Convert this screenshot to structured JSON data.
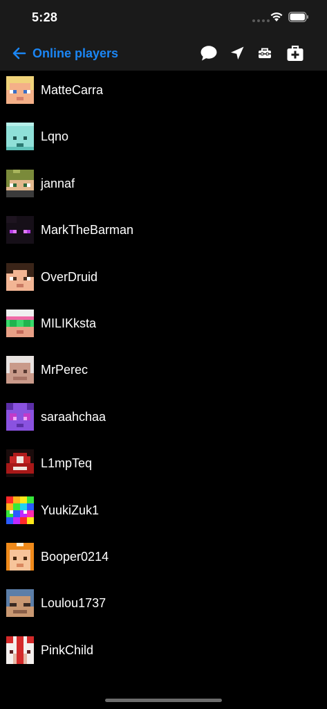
{
  "status_bar": {
    "time": "5:28",
    "signal_icon": "cellular-signal-icon",
    "wifi_icon": "wifi-icon",
    "battery_icon": "battery-icon"
  },
  "nav": {
    "back_icon": "arrow-left-icon",
    "title": "Online players",
    "actions": [
      {
        "name": "chat-button",
        "icon": "speech-bubble-icon"
      },
      {
        "name": "location-button",
        "icon": "location-arrow-icon"
      },
      {
        "name": "toolbox-button",
        "icon": "toolbox-icon"
      },
      {
        "name": "medkit-button",
        "icon": "medkit-icon"
      }
    ]
  },
  "colors": {
    "accent": "#1b86f5",
    "background": "#000000",
    "bar_background": "#1a1a1a",
    "text": "#ffffff"
  },
  "players": [
    {
      "name": "MatteCarra",
      "skin": "blonde"
    },
    {
      "name": "Lqno",
      "skin": "diamond"
    },
    {
      "name": "jannaf",
      "skin": "green-hair"
    },
    {
      "name": "MarkTheBarman",
      "skin": "enderman"
    },
    {
      "name": "OverDruid",
      "skin": "dark-hair"
    },
    {
      "name": "MILIKksta",
      "skin": "pink-goggles"
    },
    {
      "name": "MrPerec",
      "skin": "white-hair"
    },
    {
      "name": "saraahchaa",
      "skin": "purple-horns"
    },
    {
      "name": "L1mpTeq",
      "skin": "red-hood"
    },
    {
      "name": "YuukiZuk1",
      "skin": "rainbow"
    },
    {
      "name": "Booper0214",
      "skin": "fox-hood"
    },
    {
      "name": "Loulou1737",
      "skin": "blue-tan"
    },
    {
      "name": "PinkChild",
      "skin": "red-white"
    }
  ]
}
